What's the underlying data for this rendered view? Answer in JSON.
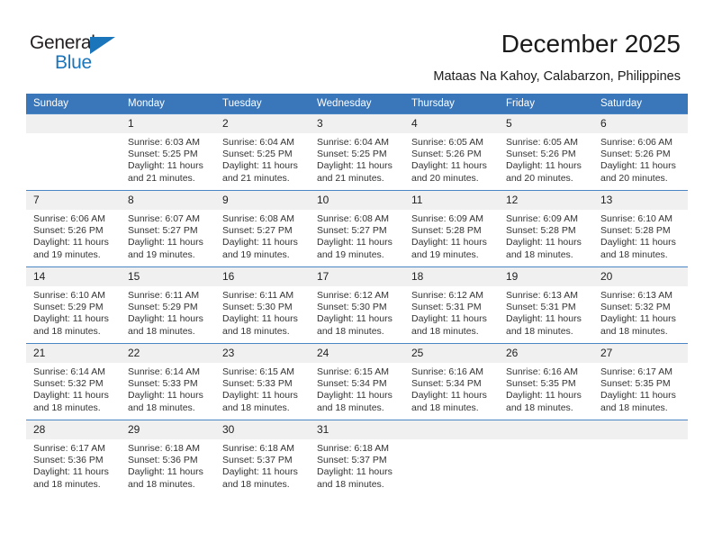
{
  "brand": {
    "name_top": "General",
    "name_bottom": "Blue",
    "triangle_color": "#1b75bb",
    "text_color": "#231f20"
  },
  "header": {
    "title": "December 2025",
    "subtitle": "Mataas Na Kahoy, Calabarzon, Philippines"
  },
  "theme": {
    "header_row_bg": "#3a76ba",
    "header_row_text": "#ffffff",
    "daynum_bg": "#f0f0f0",
    "row_divider": "#4a86c5",
    "page_bg": "#ffffff"
  },
  "calendar": {
    "weekdays": [
      "Sunday",
      "Monday",
      "Tuesday",
      "Wednesday",
      "Thursday",
      "Friday",
      "Saturday"
    ],
    "weeks": [
      [
        {
          "day": "",
          "sunrise": "",
          "sunset": "",
          "daylight_line1": "",
          "daylight_line2": "",
          "empty": true
        },
        {
          "day": "1",
          "sunrise": "Sunrise: 6:03 AM",
          "sunset": "Sunset: 5:25 PM",
          "daylight_line1": "Daylight: 11 hours",
          "daylight_line2": "and 21 minutes.",
          "empty": false
        },
        {
          "day": "2",
          "sunrise": "Sunrise: 6:04 AM",
          "sunset": "Sunset: 5:25 PM",
          "daylight_line1": "Daylight: 11 hours",
          "daylight_line2": "and 21 minutes.",
          "empty": false
        },
        {
          "day": "3",
          "sunrise": "Sunrise: 6:04 AM",
          "sunset": "Sunset: 5:25 PM",
          "daylight_line1": "Daylight: 11 hours",
          "daylight_line2": "and 21 minutes.",
          "empty": false
        },
        {
          "day": "4",
          "sunrise": "Sunrise: 6:05 AM",
          "sunset": "Sunset: 5:26 PM",
          "daylight_line1": "Daylight: 11 hours",
          "daylight_line2": "and 20 minutes.",
          "empty": false
        },
        {
          "day": "5",
          "sunrise": "Sunrise: 6:05 AM",
          "sunset": "Sunset: 5:26 PM",
          "daylight_line1": "Daylight: 11 hours",
          "daylight_line2": "and 20 minutes.",
          "empty": false
        },
        {
          "day": "6",
          "sunrise": "Sunrise: 6:06 AM",
          "sunset": "Sunset: 5:26 PM",
          "daylight_line1": "Daylight: 11 hours",
          "daylight_line2": "and 20 minutes.",
          "empty": false
        }
      ],
      [
        {
          "day": "7",
          "sunrise": "Sunrise: 6:06 AM",
          "sunset": "Sunset: 5:26 PM",
          "daylight_line1": "Daylight: 11 hours",
          "daylight_line2": "and 19 minutes.",
          "empty": false
        },
        {
          "day": "8",
          "sunrise": "Sunrise: 6:07 AM",
          "sunset": "Sunset: 5:27 PM",
          "daylight_line1": "Daylight: 11 hours",
          "daylight_line2": "and 19 minutes.",
          "empty": false
        },
        {
          "day": "9",
          "sunrise": "Sunrise: 6:08 AM",
          "sunset": "Sunset: 5:27 PM",
          "daylight_line1": "Daylight: 11 hours",
          "daylight_line2": "and 19 minutes.",
          "empty": false
        },
        {
          "day": "10",
          "sunrise": "Sunrise: 6:08 AM",
          "sunset": "Sunset: 5:27 PM",
          "daylight_line1": "Daylight: 11 hours",
          "daylight_line2": "and 19 minutes.",
          "empty": false
        },
        {
          "day": "11",
          "sunrise": "Sunrise: 6:09 AM",
          "sunset": "Sunset: 5:28 PM",
          "daylight_line1": "Daylight: 11 hours",
          "daylight_line2": "and 19 minutes.",
          "empty": false
        },
        {
          "day": "12",
          "sunrise": "Sunrise: 6:09 AM",
          "sunset": "Sunset: 5:28 PM",
          "daylight_line1": "Daylight: 11 hours",
          "daylight_line2": "and 18 minutes.",
          "empty": false
        },
        {
          "day": "13",
          "sunrise": "Sunrise: 6:10 AM",
          "sunset": "Sunset: 5:28 PM",
          "daylight_line1": "Daylight: 11 hours",
          "daylight_line2": "and 18 minutes.",
          "empty": false
        }
      ],
      [
        {
          "day": "14",
          "sunrise": "Sunrise: 6:10 AM",
          "sunset": "Sunset: 5:29 PM",
          "daylight_line1": "Daylight: 11 hours",
          "daylight_line2": "and 18 minutes.",
          "empty": false
        },
        {
          "day": "15",
          "sunrise": "Sunrise: 6:11 AM",
          "sunset": "Sunset: 5:29 PM",
          "daylight_line1": "Daylight: 11 hours",
          "daylight_line2": "and 18 minutes.",
          "empty": false
        },
        {
          "day": "16",
          "sunrise": "Sunrise: 6:11 AM",
          "sunset": "Sunset: 5:30 PM",
          "daylight_line1": "Daylight: 11 hours",
          "daylight_line2": "and 18 minutes.",
          "empty": false
        },
        {
          "day": "17",
          "sunrise": "Sunrise: 6:12 AM",
          "sunset": "Sunset: 5:30 PM",
          "daylight_line1": "Daylight: 11 hours",
          "daylight_line2": "and 18 minutes.",
          "empty": false
        },
        {
          "day": "18",
          "sunrise": "Sunrise: 6:12 AM",
          "sunset": "Sunset: 5:31 PM",
          "daylight_line1": "Daylight: 11 hours",
          "daylight_line2": "and 18 minutes.",
          "empty": false
        },
        {
          "day": "19",
          "sunrise": "Sunrise: 6:13 AM",
          "sunset": "Sunset: 5:31 PM",
          "daylight_line1": "Daylight: 11 hours",
          "daylight_line2": "and 18 minutes.",
          "empty": false
        },
        {
          "day": "20",
          "sunrise": "Sunrise: 6:13 AM",
          "sunset": "Sunset: 5:32 PM",
          "daylight_line1": "Daylight: 11 hours",
          "daylight_line2": "and 18 minutes.",
          "empty": false
        }
      ],
      [
        {
          "day": "21",
          "sunrise": "Sunrise: 6:14 AM",
          "sunset": "Sunset: 5:32 PM",
          "daylight_line1": "Daylight: 11 hours",
          "daylight_line2": "and 18 minutes.",
          "empty": false
        },
        {
          "day": "22",
          "sunrise": "Sunrise: 6:14 AM",
          "sunset": "Sunset: 5:33 PM",
          "daylight_line1": "Daylight: 11 hours",
          "daylight_line2": "and 18 minutes.",
          "empty": false
        },
        {
          "day": "23",
          "sunrise": "Sunrise: 6:15 AM",
          "sunset": "Sunset: 5:33 PM",
          "daylight_line1": "Daylight: 11 hours",
          "daylight_line2": "and 18 minutes.",
          "empty": false
        },
        {
          "day": "24",
          "sunrise": "Sunrise: 6:15 AM",
          "sunset": "Sunset: 5:34 PM",
          "daylight_line1": "Daylight: 11 hours",
          "daylight_line2": "and 18 minutes.",
          "empty": false
        },
        {
          "day": "25",
          "sunrise": "Sunrise: 6:16 AM",
          "sunset": "Sunset: 5:34 PM",
          "daylight_line1": "Daylight: 11 hours",
          "daylight_line2": "and 18 minutes.",
          "empty": false
        },
        {
          "day": "26",
          "sunrise": "Sunrise: 6:16 AM",
          "sunset": "Sunset: 5:35 PM",
          "daylight_line1": "Daylight: 11 hours",
          "daylight_line2": "and 18 minutes.",
          "empty": false
        },
        {
          "day": "27",
          "sunrise": "Sunrise: 6:17 AM",
          "sunset": "Sunset: 5:35 PM",
          "daylight_line1": "Daylight: 11 hours",
          "daylight_line2": "and 18 minutes.",
          "empty": false
        }
      ],
      [
        {
          "day": "28",
          "sunrise": "Sunrise: 6:17 AM",
          "sunset": "Sunset: 5:36 PM",
          "daylight_line1": "Daylight: 11 hours",
          "daylight_line2": "and 18 minutes.",
          "empty": false
        },
        {
          "day": "29",
          "sunrise": "Sunrise: 6:18 AM",
          "sunset": "Sunset: 5:36 PM",
          "daylight_line1": "Daylight: 11 hours",
          "daylight_line2": "and 18 minutes.",
          "empty": false
        },
        {
          "day": "30",
          "sunrise": "Sunrise: 6:18 AM",
          "sunset": "Sunset: 5:37 PM",
          "daylight_line1": "Daylight: 11 hours",
          "daylight_line2": "and 18 minutes.",
          "empty": false
        },
        {
          "day": "31",
          "sunrise": "Sunrise: 6:18 AM",
          "sunset": "Sunset: 5:37 PM",
          "daylight_line1": "Daylight: 11 hours",
          "daylight_line2": "and 18 minutes.",
          "empty": false
        },
        {
          "day": "",
          "sunrise": "",
          "sunset": "",
          "daylight_line1": "",
          "daylight_line2": "",
          "empty": true
        },
        {
          "day": "",
          "sunrise": "",
          "sunset": "",
          "daylight_line1": "",
          "daylight_line2": "",
          "empty": true
        },
        {
          "day": "",
          "sunrise": "",
          "sunset": "",
          "daylight_line1": "",
          "daylight_line2": "",
          "empty": true
        }
      ]
    ]
  }
}
